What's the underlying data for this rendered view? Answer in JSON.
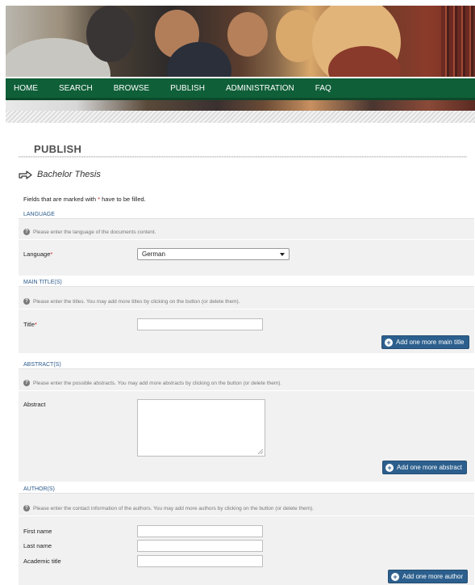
{
  "nav": {
    "items": [
      "HOME",
      "SEARCH",
      "BROWSE",
      "PUBLISH",
      "ADMINISTRATION",
      "FAQ"
    ]
  },
  "page": {
    "title": "PUBLISH",
    "doc_type": "Bachelor Thesis",
    "required_note_pre": "Fields that are marked with ",
    "required_star": "*",
    "required_note_post": " have to be filled."
  },
  "sections": {
    "language": {
      "label": "LANGUAGE",
      "hint": "Please enter the language of the documents content.",
      "field_label": "Language",
      "selected": "German"
    },
    "main_titles": {
      "label": "MAIN TITLE(S)",
      "hint": "Please enter the titles. You may add more titles by clicking on the button (or delete them).",
      "field_label": "Title",
      "value": "",
      "button": "Add one more main title"
    },
    "abstracts": {
      "label": "ABSTRACT(S)",
      "hint": "Please enter the possible abstracts. You may add more abstracts by clicking on the button (or delete them).",
      "field_label": "Abstract",
      "value": "",
      "button": "Add one more abstract"
    },
    "authors": {
      "label": "AUTHOR(S)",
      "hint": "Please enter the contact information of the authors. You may add more authors by clicking on the button (or delete them).",
      "first_name_label": "First name",
      "last_name_label": "Last name",
      "academic_title_label": "Academic title",
      "first_name": "",
      "last_name": "",
      "academic_title": "",
      "button": "Add one more author"
    }
  },
  "colors": {
    "nav_bg": "#0f5f38",
    "button_bg": "#2c5f8d",
    "required_star": "#d02020",
    "panel_bg": "#f1f1f1"
  },
  "icons": {
    "doc_type": "arrow-right-icon",
    "hint": "question-circle-icon",
    "button": "plus-circle-icon"
  }
}
